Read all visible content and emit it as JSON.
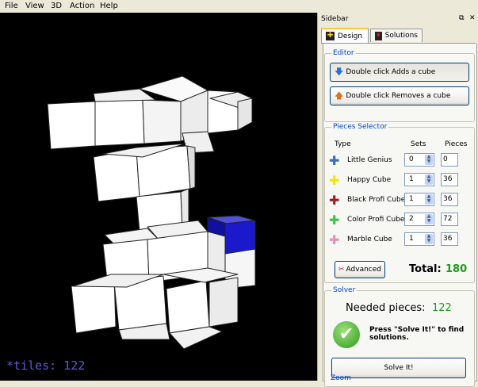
{
  "menu": [
    "File",
    "View",
    "3D",
    "Action",
    "Help"
  ],
  "viewport": {
    "tiles_label": "*tiles: 122"
  },
  "sidebar": {
    "title": "Sidebar",
    "tabs": [
      {
        "label": "Design",
        "active": true
      },
      {
        "label": "Solutions",
        "active": false
      }
    ],
    "editor": {
      "title": "Editor",
      "add_button": "Double click Adds a cube",
      "remove_button": "Double click Removes a cube"
    },
    "pieces": {
      "title": "Pieces Selector",
      "col_type": "Type",
      "col_sets": "Sets",
      "col_pieces": "Pieces",
      "rows": [
        {
          "name": "Little Genius",
          "sets": "0",
          "pieces": "0",
          "color": "#3a6fb5"
        },
        {
          "name": "Happy Cube",
          "sets": "1",
          "pieces": "36",
          "color": "#f2e600"
        },
        {
          "name": "Black Profi Cube",
          "sets": "1",
          "pieces": "36",
          "color": "#a01e1e"
        },
        {
          "name": "Color Profi Cube",
          "sets": "2",
          "pieces": "72",
          "color": "#3fc43f"
        },
        {
          "name": "Marble Cube",
          "sets": "1",
          "pieces": "36",
          "color": "#e98fb8"
        }
      ],
      "advanced_button": "Advanced",
      "total_label": "Total:",
      "total_value": "180"
    },
    "solver": {
      "title": "Solver",
      "needed_label": "Needed pieces:",
      "needed_value": "122",
      "hint": "Press \"Solve It!\" to find solutions.",
      "solve_button": "Solve It!"
    },
    "zoom_title": "Zoom"
  },
  "colors": {
    "accent_green": "#1c9b1c",
    "tiles_text": "#5a5ad8",
    "selected_cube": "#1a1acc"
  }
}
